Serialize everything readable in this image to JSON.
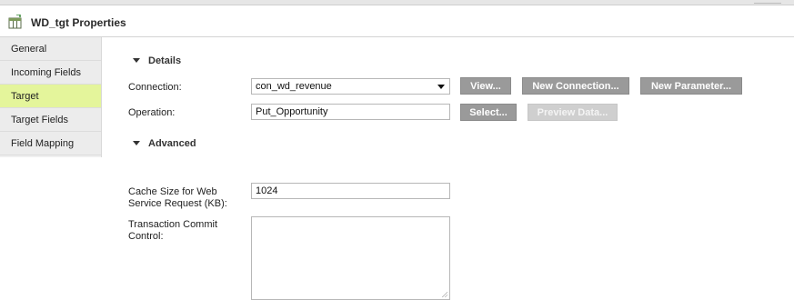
{
  "panel": {
    "title": "WD_tgt Properties",
    "icon": "table-target-icon"
  },
  "sidebar": {
    "items": [
      {
        "label": "General"
      },
      {
        "label": "Incoming Fields"
      },
      {
        "label": "Target",
        "active": true
      },
      {
        "label": "Target Fields"
      },
      {
        "label": "Field Mapping"
      }
    ]
  },
  "details": {
    "heading": "Details",
    "connection_label": "Connection:",
    "connection_value": "con_wd_revenue",
    "operation_label": "Operation:",
    "operation_value": "Put_Opportunity",
    "buttons": {
      "view": "View...",
      "new_connection": "New Connection...",
      "new_parameter": "New Parameter...",
      "select": "Select...",
      "preview_data": "Preview Data..."
    }
  },
  "advanced": {
    "heading": "Advanced",
    "cache_label": "Cache Size for Web Service Request (KB):",
    "cache_value": "1024",
    "commit_label": "Transaction Commit Control:",
    "commit_value": ""
  },
  "colors": {
    "active_tab": "#e4f59b",
    "button": "#9a9a9a",
    "button_disabled": "#cfcfcf"
  }
}
